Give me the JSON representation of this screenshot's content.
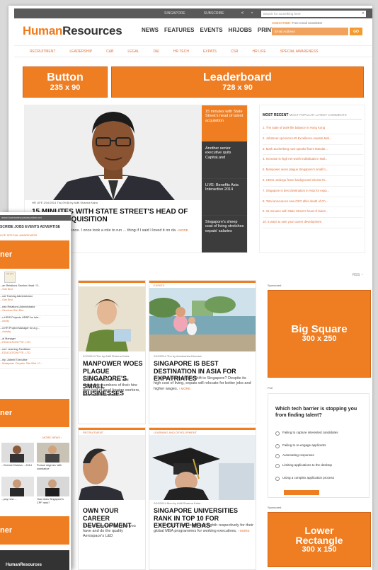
{
  "topbar": {
    "links": [
      "SINGAPORE",
      "SUBSCRIBE"
    ],
    "search_placeholder": "Search for something here"
  },
  "logo": {
    "part1": "Human",
    "part2": "Resources"
  },
  "main_nav": [
    "NEWS",
    "FEATURES",
    "EVENTS",
    "HRJOBS",
    "PRINT"
  ],
  "subscribe": {
    "label": "SUBSCRIBE:",
    "note": "Free email newsletter",
    "email_placeholder": "Email Address",
    "go_label": "GO"
  },
  "sub_nav": [
    "RECRUITMENT",
    "LEADERSHIP",
    "C&B",
    "LEGAL",
    "D&I",
    "HR TECH",
    "EXPATS",
    "CSR",
    "HR LIFE",
    "SPECIAL AWARENESS"
  ],
  "ads": {
    "button": {
      "line1": "Button",
      "line2": "235 x 90"
    },
    "leaderboard": {
      "line1": "Leaderboard",
      "line2": "728 x 90"
    },
    "big_square": {
      "line1": "Big Square",
      "line2": "300 x 250"
    },
    "lower_rect": {
      "line1": "Lower",
      "line2": "Rectangle",
      "line3": "300 x 150"
    }
  },
  "hero": {
    "category": "HR LIFE   2/10/2014 Thu 09:56 by Aditi Sharma Kalra",
    "title": "15 MINUTES WITH STATE STREET'S HEAD OF TALENT ACQUISITION",
    "excerpt": "... is a priceless experience. I once took a role to run ... thing if I said I loved it on da",
    "more": "› MORE"
  },
  "side_items": [
    "15 minutes with State Street's head of talent acquisition",
    "Another senior executive quits CapitaLand",
    "LIVE: Benefits Asia Interactive 2014",
    "Singapore's sheep coat of living stretches expats' salaries"
  ],
  "most_recent": {
    "tab_active": "MOST RECENT",
    "tab_others": "MOST POPULAR   LATEST COMMENTS",
    "items": [
      "1. The state of work-life balance in Hong Kong",
      "2. Jobstreet sponsors HR Excellence Awards Mal...",
      "3. Mark Zuckerberg now speaks fluent Mandar...",
      "4. Increase in high net worth individuals in Mal...",
      "5. Manpower woes plague Singapore's small b...",
      "6. CEOs undergo fewer background checks th...",
      "7. Singapore is best destination in Asia for expa...",
      "8. Total announces new CEO after death of Ch...",
      "9. 15 minutes with State Street's head of talent...",
      "10. 5 ways to own your career development"
    ]
  },
  "rss_label": "RSS",
  "cards": [
    {
      "category": "",
      "meta": "2/10/2014 Thu by Aditi Sharma Kalra",
      "title": "MANPOWER WOES PLAGUE SINGAPORE'S SMALL BUSINESSES",
      "excerpt": "SMEs continue to hire and increasing numbers of their hire than half of local foreign workers, their business model.",
      "more": ""
    },
    {
      "category": "EXPATS",
      "meta": "2/10/2014 Thu by Anushanka Desvani",
      "title": "SINGAPORE IS BEST DESTINATION IN ASIA FOR EXPATRIATES",
      "excerpt": "Are your staff itching to shift to Singapore? Despite its high cost of living, expats will relocate for better jobs and higher wages.",
      "more": "› MORE"
    },
    {
      "category": "RECRUITMENT",
      "meta": "",
      "title": "OWN YOUR CAREER DEVELOPMENT",
      "excerpt": "It's time to want more than you have and do the quality Aerospace's L&D",
      "more": ""
    },
    {
      "category": "LEARNING AND DEVELOPMENT",
      "meta": "2/10/2014 Mon by Aditi Sharma Kalra",
      "title": "SINGAPORE UNIVERSITIES RANK IN TOP 10 FOR EXECUTIVE MBAS",
      "excerpt": "NUS and NTU rank fourth and eighth respectively for their global MBA programmes for working executives.",
      "more": "› MORE"
    }
  ],
  "sponsored_label": "Sponsored",
  "poll": {
    "label": "Poll",
    "question": "Which tech barrier is stopping you from finding talent?",
    "options": [
      "Failing to capture interested candidates",
      "Failing to re-engage applicants",
      "Automating responses",
      "Limiting applications to the desktop",
      "Using a complex application process"
    ]
  },
  "overlay": {
    "topbar": "www.humanresourcesonline.net",
    "nav": "SCRIBE  JOBS  EVENTS  ADVERTISE",
    "sub": "LIFE    SPECIAL AWARENESS",
    "ad_text": "ner",
    "jobs": [
      {
        "title": "...an Relations Section Head / S...",
        "sub": "...Sdn Bhd"
      },
      {
        "title": "...nal Training Administrator",
        "sub": "...Sdn Bhd"
      },
      {
        "title": "...ean Relations Administrator",
        "sub": "...Services Sdn Bhd"
      },
      {
        "title": "...s HRIS Projects HRBP for Inte...",
        "sub": "...ctivity"
      },
      {
        "title": "...d HR Project Manager for a g...",
        "sub": "...Activity"
      },
      {
        "title": "...al Manager",
        "sub": "...EDUCATION PTE. LTD."
      },
      {
        "title": "...ner/ Learning Facilitator",
        "sub": "...EDUCATION PTE. LTD."
      },
      {
        "title": "...ntp. Admin Executive",
        "sub": "...Malaysian Chrysler Sdn Bhd I C..."
      }
    ],
    "more_news": "MORE NEWS ›",
    "jobs_badge": "HR jobs",
    "news": [
      "...Service Division ...2014",
      "Pursue degrees 'with substance'",
      "...pay new ...",
      "How does Singapore's CPF rank?"
    ],
    "footer": "HumanResources"
  }
}
